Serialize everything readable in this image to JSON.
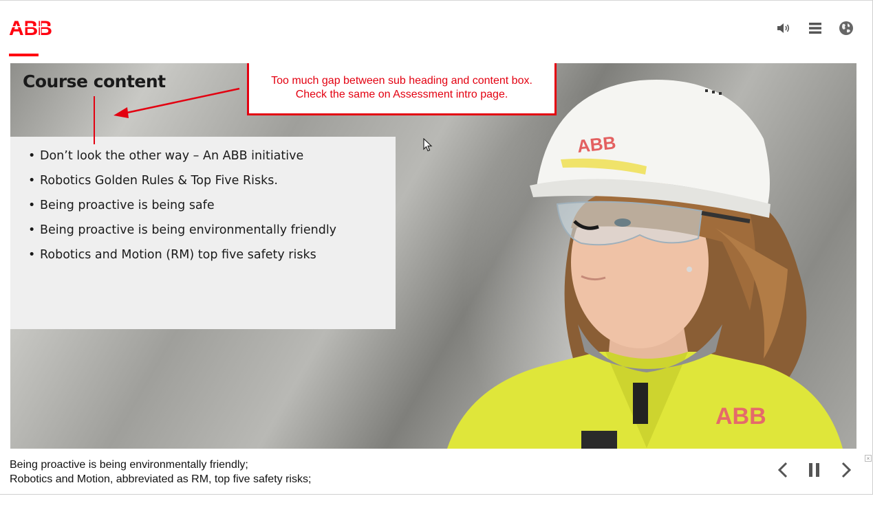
{
  "brand": {
    "logo_text": "ABB",
    "accent": "#ff000f"
  },
  "toolbar": {
    "icons": [
      "speaker-icon",
      "menu-icon",
      "globe-icon"
    ]
  },
  "slide": {
    "heading": "Course content",
    "bullets": [
      "Don’t look the other way – An ABB initiative",
      "Robotics Golden Rules & Top Five Risks.",
      "Being proactive is being safe",
      "Being proactive is being environmentally friendly",
      "Robotics and Motion (RM) top five safety risks"
    ]
  },
  "annotation": {
    "line1": "Too much gap between sub heading and content box.",
    "line2": "Check the same on Assessment intro page.",
    "color": "#e30010"
  },
  "photo": {
    "helmet_logo": "ABB",
    "jacket_logo": "ABB"
  },
  "caption": {
    "line1": "Being proactive is being environmentally friendly;",
    "line2": "Robotics and Motion, abbreviated as RM, top five safety risks;"
  },
  "nav": {
    "icons": [
      "chevron-left-icon",
      "pause-icon",
      "chevron-right-icon"
    ]
  }
}
